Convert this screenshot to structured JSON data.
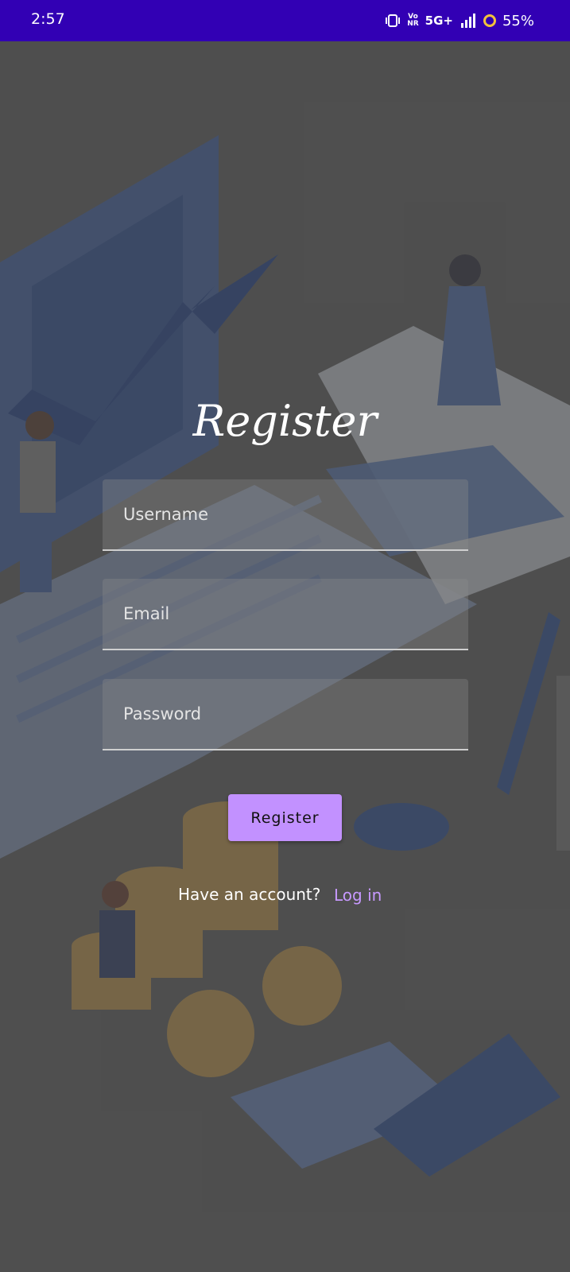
{
  "status_bar": {
    "time": "2:57",
    "volte": "Vo\nNR",
    "network": "5G+",
    "battery": "55%"
  },
  "form": {
    "title": "Register",
    "username_placeholder": "Username",
    "email_placeholder": "Email",
    "password_placeholder": "Password",
    "register_label": "Register",
    "have_account": "Have an account?",
    "login_label": "Log in"
  },
  "colors": {
    "status_bar": "#3200b4",
    "accent": "#c291ff",
    "link": "#c799ff"
  }
}
